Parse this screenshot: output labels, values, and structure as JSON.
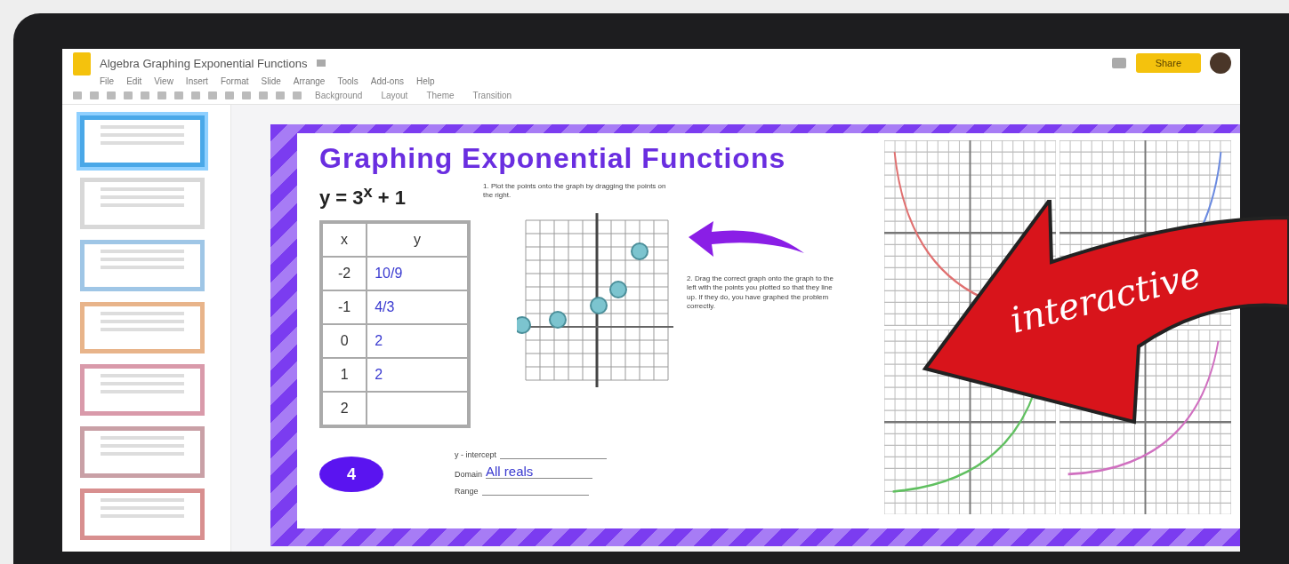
{
  "window": {
    "title": "Algebra Graphing Exponential Functions"
  },
  "menu": [
    "File",
    "Edit",
    "View",
    "Insert",
    "Format",
    "Slide",
    "Arrange",
    "Tools",
    "Add-ons",
    "Help"
  ],
  "toolbar": [
    "Background",
    "Layout",
    "Theme",
    "Transition"
  ],
  "share_button": "Share",
  "filmstrip": [
    {
      "selected": true,
      "color": "#4aa8e8"
    },
    {
      "selected": false,
      "color": "#d8d8d8"
    },
    {
      "selected": false,
      "color": "#9fc6e6"
    },
    {
      "selected": false,
      "color": "#e8b48a"
    },
    {
      "selected": false,
      "color": "#d99aaa"
    },
    {
      "selected": false,
      "color": "#c9a0a6"
    },
    {
      "selected": false,
      "color": "#d88f8f"
    }
  ],
  "slide": {
    "title": "Graphing Exponential Functions",
    "equation": "y = 3$^{x}$ + 1",
    "table": {
      "columns": [
        "x",
        "y"
      ],
      "rows": [
        [
          "-2",
          "10/9"
        ],
        [
          "-1",
          "4/3"
        ],
        [
          "0",
          "2"
        ],
        [
          "1",
          "2"
        ],
        [
          "2"
        ]
      ]
    },
    "step_1": "1. Plot the points onto the graph by dragging the points on the right.",
    "step_2": "2. Drag the correct graph onto the graph to the left with the points you plotted so that they line up. If they do, you have graphed the problem correctly.",
    "fields": [
      {
        "label": "y - intercept"
      },
      {
        "label": "Domain",
        "value": "All reals"
      },
      {
        "label": "Range"
      }
    ],
    "slide_number": "4"
  },
  "overlay": {
    "label": "interactive"
  }
}
